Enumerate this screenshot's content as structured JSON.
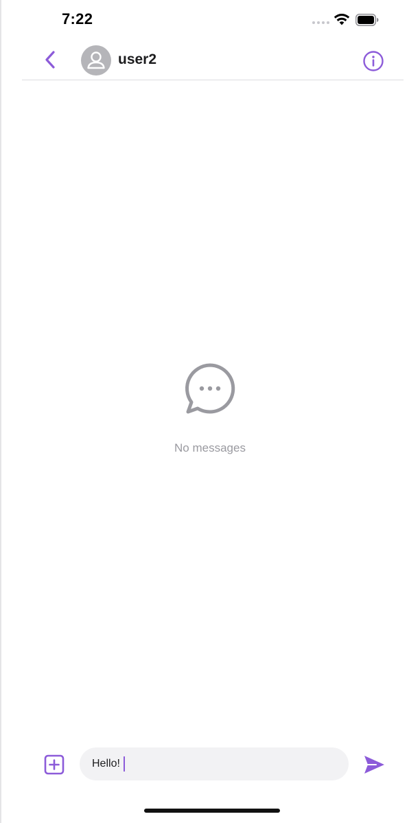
{
  "status_bar": {
    "time": "7:22"
  },
  "header": {
    "user_name": "user2",
    "back_icon": "chevron-left-icon",
    "info_icon": "info-circle-icon",
    "avatar_icon": "person-icon"
  },
  "empty_state": {
    "icon": "chat-bubble-ellipsis-icon",
    "text": "No messages"
  },
  "composer": {
    "attach_icon": "plus-square-icon",
    "input_value": "Hello!",
    "send_icon": "paper-plane-icon"
  },
  "colors": {
    "accent": "#8C5BD9",
    "muted_text": "#9A9AA0",
    "input_background": "#F2F2F4",
    "avatar_background": "#B5B5B9"
  }
}
